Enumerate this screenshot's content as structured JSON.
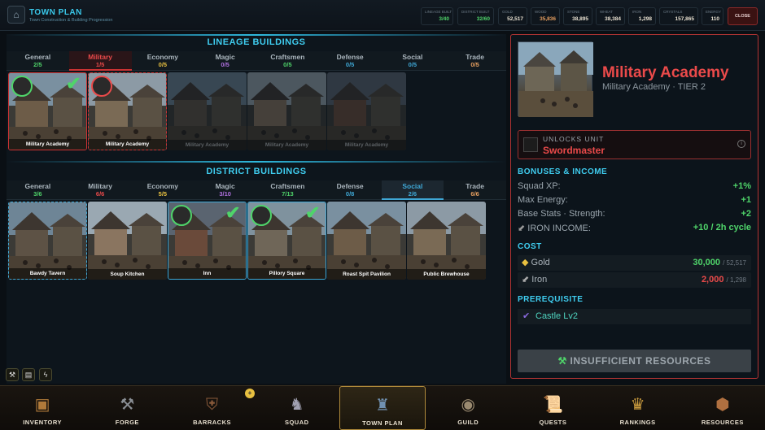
{
  "header": {
    "title": "TOWN PLAN",
    "subtitle": "Town Construction & Building Progression",
    "close_label": "CLOSE"
  },
  "resources": [
    {
      "label": "LINEAGE BUILT",
      "value": "3/40",
      "color": "#4fd46a",
      "icon": ""
    },
    {
      "label": "DISTRICT BUILT",
      "value": "32/60",
      "color": "#4fd46a",
      "icon": ""
    },
    {
      "label": "GOLD",
      "value": "52,517",
      "color": "#e8e0d0",
      "icon": "gold-icon"
    },
    {
      "label": "WOOD",
      "value": "35,836",
      "color": "#e8a060",
      "icon": "wood-icon"
    },
    {
      "label": "STONE",
      "value": "38,895",
      "color": "#e8e0d0",
      "icon": "stone-icon"
    },
    {
      "label": "WHEAT",
      "value": "38,384",
      "color": "#e8e0d0",
      "icon": "wheat-icon"
    },
    {
      "label": "IRON",
      "value": "1,298",
      "color": "#e8e0d0",
      "icon": "iron-icon"
    },
    {
      "label": "CRYSTALS",
      "value": "157,865",
      "color": "#e8e0d0",
      "icon": "crystal-icon"
    },
    {
      "label": "ENERGY",
      "value": "110",
      "color": "#e8e0d0",
      "icon": "energy-icon"
    }
  ],
  "lineage": {
    "title": "LINEAGE BUILDINGS",
    "tabs": [
      {
        "name": "General",
        "count": "2/5",
        "color": "#4fd46a"
      },
      {
        "name": "Military",
        "count": "1/5",
        "color": "#ea4a4a"
      },
      {
        "name": "Economy",
        "count": "0/5",
        "color": "#e8c040"
      },
      {
        "name": "Magic",
        "count": "0/5",
        "color": "#b070e0"
      },
      {
        "name": "Craftsmen",
        "count": "0/5",
        "color": "#4fd46a"
      },
      {
        "name": "Defense",
        "count": "0/5",
        "color": "#3fa8d6"
      },
      {
        "name": "Social",
        "count": "0/5",
        "color": "#3fa8d6"
      },
      {
        "name": "Trade",
        "count": "0/5",
        "color": "#e8a060"
      }
    ],
    "cards": [
      {
        "label": "Military Academy",
        "state": "built"
      },
      {
        "label": "Military Academy",
        "state": "selected"
      },
      {
        "label": "Military Academy",
        "state": "locked"
      },
      {
        "label": "Military Academy",
        "state": "locked"
      },
      {
        "label": "Military Academy",
        "state": "locked"
      }
    ]
  },
  "district": {
    "title": "DISTRICT BUILDINGS",
    "tabs": [
      {
        "name": "General",
        "count": "3/6",
        "color": "#4fd46a"
      },
      {
        "name": "Military",
        "count": "6/6",
        "color": "#ea4a4a"
      },
      {
        "name": "Economy",
        "count": "5/5",
        "color": "#e8c040"
      },
      {
        "name": "Magic",
        "count": "3/10",
        "color": "#b070e0"
      },
      {
        "name": "Craftsmen",
        "count": "7/13",
        "color": "#4fd46a"
      },
      {
        "name": "Defense",
        "count": "0/8",
        "color": "#3fa8d6"
      },
      {
        "name": "Social",
        "count": "2/6",
        "color": "#3fa8d6"
      },
      {
        "name": "Trade",
        "count": "6/6",
        "color": "#e8a060"
      }
    ],
    "cards": [
      {
        "label": "Bawdy Tavern"
      },
      {
        "label": "Soup Kitchen"
      },
      {
        "label": "Inn"
      },
      {
        "label": "Pillory Square"
      },
      {
        "label": "Roast Spit Pavilion"
      },
      {
        "label": "Public Brewhouse"
      }
    ]
  },
  "detail": {
    "name": "Military Academy",
    "subtitle": "Military Academy · TIER 2",
    "unlocks_label": "UNLOCKS UNIT",
    "unit": "Swordmaster",
    "bonuses_title": "BONUSES & INCOME",
    "bonuses": [
      {
        "label": "Squad XP:",
        "value": "+1%"
      },
      {
        "label": "Max Energy:",
        "value": "+1"
      },
      {
        "label": "Base Stats · Strength:",
        "value": "+2"
      },
      {
        "label": "IRON INCOME:",
        "value": "+10 / 2h cycle"
      }
    ],
    "cost_title": "COST",
    "costs": [
      {
        "label": "Gold",
        "need": "30,000",
        "have": "/ 52,517",
        "color": "#4fd46a"
      },
      {
        "label": "Iron",
        "need": "2,000",
        "have": "/ 1,298",
        "color": "#ea4a4a"
      }
    ],
    "prereq_title": "PREREQUISITE",
    "prereq": "Castle Lv2",
    "action": "INSUFFICIENT RESOURCES"
  },
  "nav": [
    {
      "label": "INVENTORY",
      "icon": "chest-icon"
    },
    {
      "label": "FORGE",
      "icon": "anvil-icon"
    },
    {
      "label": "BARRACKS",
      "icon": "shield-icon"
    },
    {
      "label": "SQUAD",
      "icon": "squad-icon"
    },
    {
      "label": "TOWN PLAN",
      "icon": "castle-icon"
    },
    {
      "label": "GUILD",
      "icon": "guild-icon"
    },
    {
      "label": "QUESTS",
      "icon": "scroll-icon"
    },
    {
      "label": "RANKINGS",
      "icon": "trophy-icon"
    },
    {
      "label": "RESOURCES",
      "icon": "resources-icon"
    }
  ]
}
